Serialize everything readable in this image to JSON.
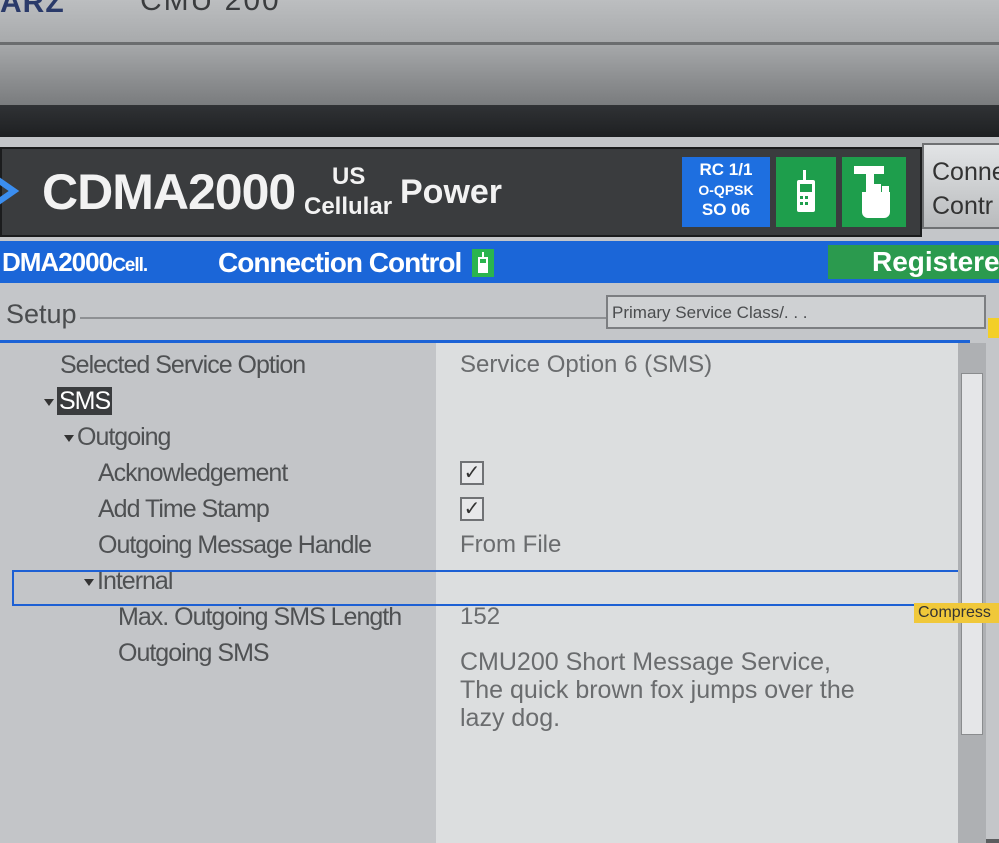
{
  "bezel": {
    "brand": "ARZ",
    "model": "CMU 200"
  },
  "title_bar": {
    "main_title": "CDMA2000",
    "region_top": "US",
    "region_bottom": "Cellular",
    "mode": "Power",
    "rc": {
      "line1": "RC 1/1",
      "line2": "O-QPSK",
      "line3": "SO 06"
    },
    "side_button": {
      "line1": "Conne",
      "line2": "Contr"
    }
  },
  "status_bar": {
    "cell_main": "DMA2000",
    "cell_suffix": "Cell.",
    "connection": "Connection Control",
    "registered": "Registere"
  },
  "setup": {
    "label": "Setup",
    "primary_dropdown": "Primary Service Class/. . ."
  },
  "rows": {
    "selected_service_option": {
      "label": "Selected Service Option",
      "value": "Service Option 6   (SMS)"
    },
    "sms": {
      "label": "SMS"
    },
    "outgoing": {
      "label": "Outgoing"
    },
    "acknowledgement": {
      "label": "Acknowledgement",
      "checked": true
    },
    "add_time_stamp": {
      "label": "Add Time Stamp",
      "checked": true
    },
    "outgoing_message_handle": {
      "label": "Outgoing Message Handle",
      "value": "From File"
    },
    "internal": {
      "label": "Internal"
    },
    "max_outgoing_sms_length": {
      "label": "Max. Outgoing SMS Length",
      "value": "152"
    },
    "outgoing_sms": {
      "label": "Outgoing SMS",
      "value_line1": "CMU200 Short Message Service,",
      "value_line2": "The quick brown fox jumps over the",
      "value_line3": "lazy dog."
    }
  },
  "compress_tag": "Compress",
  "check_glyph": "✓",
  "colors": {
    "accent_blue": "#1b66d8",
    "status_green": "#2b9a4e",
    "title_bg": "#3a3c3e",
    "tag_yellow": "#f0c83a"
  }
}
